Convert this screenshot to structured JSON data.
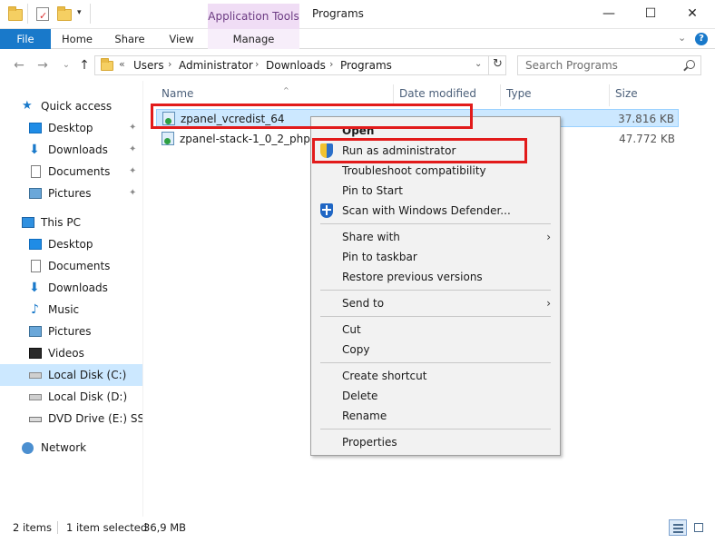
{
  "window": {
    "title": "Programs",
    "context_tab_header": "Application Tools",
    "minimize": "—",
    "maximize": "☐",
    "close": "✕"
  },
  "ribbon": {
    "tabs": [
      "File",
      "Home",
      "Share",
      "View",
      "Manage"
    ],
    "help": "?"
  },
  "address": {
    "overflow": "«",
    "crumbs": [
      "Users",
      "Administrator",
      "Downloads",
      "Programs"
    ],
    "separator": "›",
    "search_placeholder": "Search Programs"
  },
  "sidebar": {
    "items": [
      {
        "label": "Quick access",
        "icon": "star-icon"
      },
      {
        "label": "Desktop",
        "icon": "desktop-icon",
        "pinned": true
      },
      {
        "label": "Downloads",
        "icon": "download-arrow-icon",
        "pinned": true
      },
      {
        "label": "Documents",
        "icon": "documents-icon",
        "pinned": true
      },
      {
        "label": "Pictures",
        "icon": "pictures-icon",
        "pinned": true
      },
      {
        "label": "This PC",
        "icon": "computer-icon"
      },
      {
        "label": "Desktop",
        "icon": "desktop-icon"
      },
      {
        "label": "Documents",
        "icon": "documents-icon"
      },
      {
        "label": "Downloads",
        "icon": "download-arrow-icon"
      },
      {
        "label": "Music",
        "icon": "music-note-icon"
      },
      {
        "label": "Pictures",
        "icon": "pictures-icon"
      },
      {
        "label": "Videos",
        "icon": "video-film-icon"
      },
      {
        "label": "Local Disk (C:)",
        "icon": "disk-drive-icon",
        "selected": true
      },
      {
        "label": "Local Disk (D:)",
        "icon": "disk-drive-icon"
      },
      {
        "label": "DVD Drive (E:) SSS_X",
        "icon": "dvd-drive-icon"
      },
      {
        "label": "Network",
        "icon": "network-icon"
      }
    ],
    "pin_glyph": "📌"
  },
  "file_list": {
    "columns": [
      "Name",
      "Date modified",
      "Type",
      "Size"
    ],
    "sort_glyph": "^",
    "rows": [
      {
        "name": "zpanel_vcredist_64",
        "size": "37.816 KB",
        "selected": true
      },
      {
        "name": "zpanel-stack-1_0_2_php53",
        "size": "47.772 KB",
        "selected": false
      }
    ]
  },
  "context_menu": {
    "items": [
      {
        "label": "Open",
        "bold": true
      },
      {
        "label": "Run as administrator",
        "icon": "uac-shield-icon"
      },
      {
        "label": "Troubleshoot compatibility"
      },
      {
        "label": "Pin to Start"
      },
      {
        "label": "Scan with Windows Defender...",
        "icon": "windows-defender-icon"
      },
      {
        "label": "Share with",
        "submenu": true
      },
      {
        "label": "Pin to taskbar"
      },
      {
        "label": "Restore previous versions"
      },
      {
        "label": "Send to",
        "submenu": true
      },
      {
        "label": "Cut"
      },
      {
        "label": "Copy"
      },
      {
        "label": "Create shortcut"
      },
      {
        "label": "Delete"
      },
      {
        "label": "Rename"
      },
      {
        "label": "Properties"
      }
    ],
    "submenu_glyph": "›"
  },
  "status": {
    "item_count": "2 items",
    "selection": "1 item selected",
    "selection_size": "36,9 MB"
  },
  "colors": {
    "accent": "#1979ca",
    "selection": "#cce8ff",
    "highlight_box": "#e21b1b",
    "context_tab": "#f0ddf5"
  }
}
